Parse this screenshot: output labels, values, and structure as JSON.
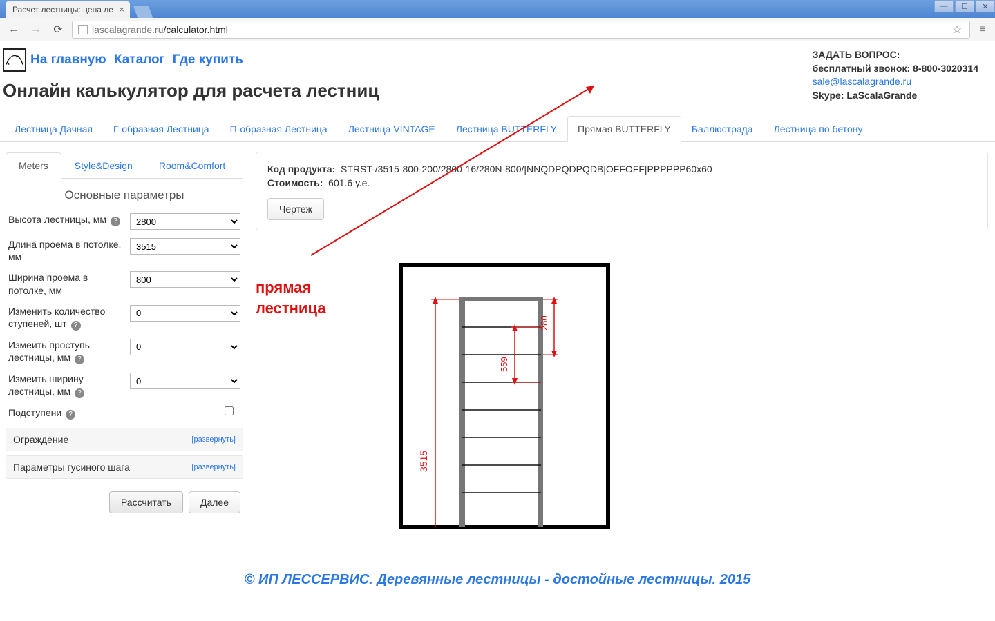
{
  "browser": {
    "tab_title": "Расчет лестницы: цена ле",
    "url_host": "lascalagrande.ru",
    "url_path": "/calculator.html"
  },
  "nav": {
    "home": "На главную",
    "catalog": "Каталог",
    "where": "Где купить"
  },
  "page_title": "Онлайн калькулятор для расчета лестниц",
  "contact": {
    "ask": "ЗАДАТЬ ВОПРОС:",
    "free_call": "бесплатный звонок: 8-800-3020314",
    "email": "sale@lascalagrande.ru",
    "skype_label": "Skype: LaScalaGrande"
  },
  "top_tabs": {
    "t0": "Лестница Дачная",
    "t1": "Г-образная Лестница",
    "t2": "П-образная Лестница",
    "t3": "Лестница VINTAGE",
    "t4": "Лестница BUTTERFLY",
    "t5": "Прямая BUTTERFLY",
    "t6": "Баллюстрада",
    "t7": "Лестница по бетону"
  },
  "sub_tabs": {
    "s0": "Meters",
    "s1": "Style&Design",
    "s2": "Room&Comfort"
  },
  "section_title": "Основные параметры",
  "form": {
    "height_label": "Высота лестницы, мм",
    "height_value": "2800",
    "length_label": "Длина проема в потолке, мм",
    "length_value": "3515",
    "width_label": "Ширина проема в потолке, мм",
    "width_value": "800",
    "steps_label": "Изменить количество ступеней, шт",
    "steps_value": "0",
    "tread_label": "Измеить проступь лестницы, мм",
    "tread_value": "0",
    "stair_width_label": "Измеить ширину лестницы, мм",
    "stair_width_value": "0",
    "riser_label": "Подступени"
  },
  "collapse": {
    "rail": "Ограждение",
    "goose": "Параметры гусиного шага",
    "expand": "[развернуть]"
  },
  "buttons": {
    "calc": "Рассчитать",
    "next": "Далее",
    "drawing": "Чертеж"
  },
  "product": {
    "code_label": "Код продукта:",
    "code_value": "STRST-/3515-800-200/2800-16/280N-800/|NNQDPQDPQDB|OFFOFF|PPPPPP60x60",
    "price_label": "Стоимость:",
    "price_value": "601.6 у.е."
  },
  "annotation": {
    "line1": "прямая",
    "line2": "лестница"
  },
  "drawing_dims": {
    "d1": "3515",
    "d2": "559",
    "d3": "280"
  },
  "footer": "© ИП ЛЕССЕРВИС. Деревянные лестницы - достойные лестницы. 2015"
}
